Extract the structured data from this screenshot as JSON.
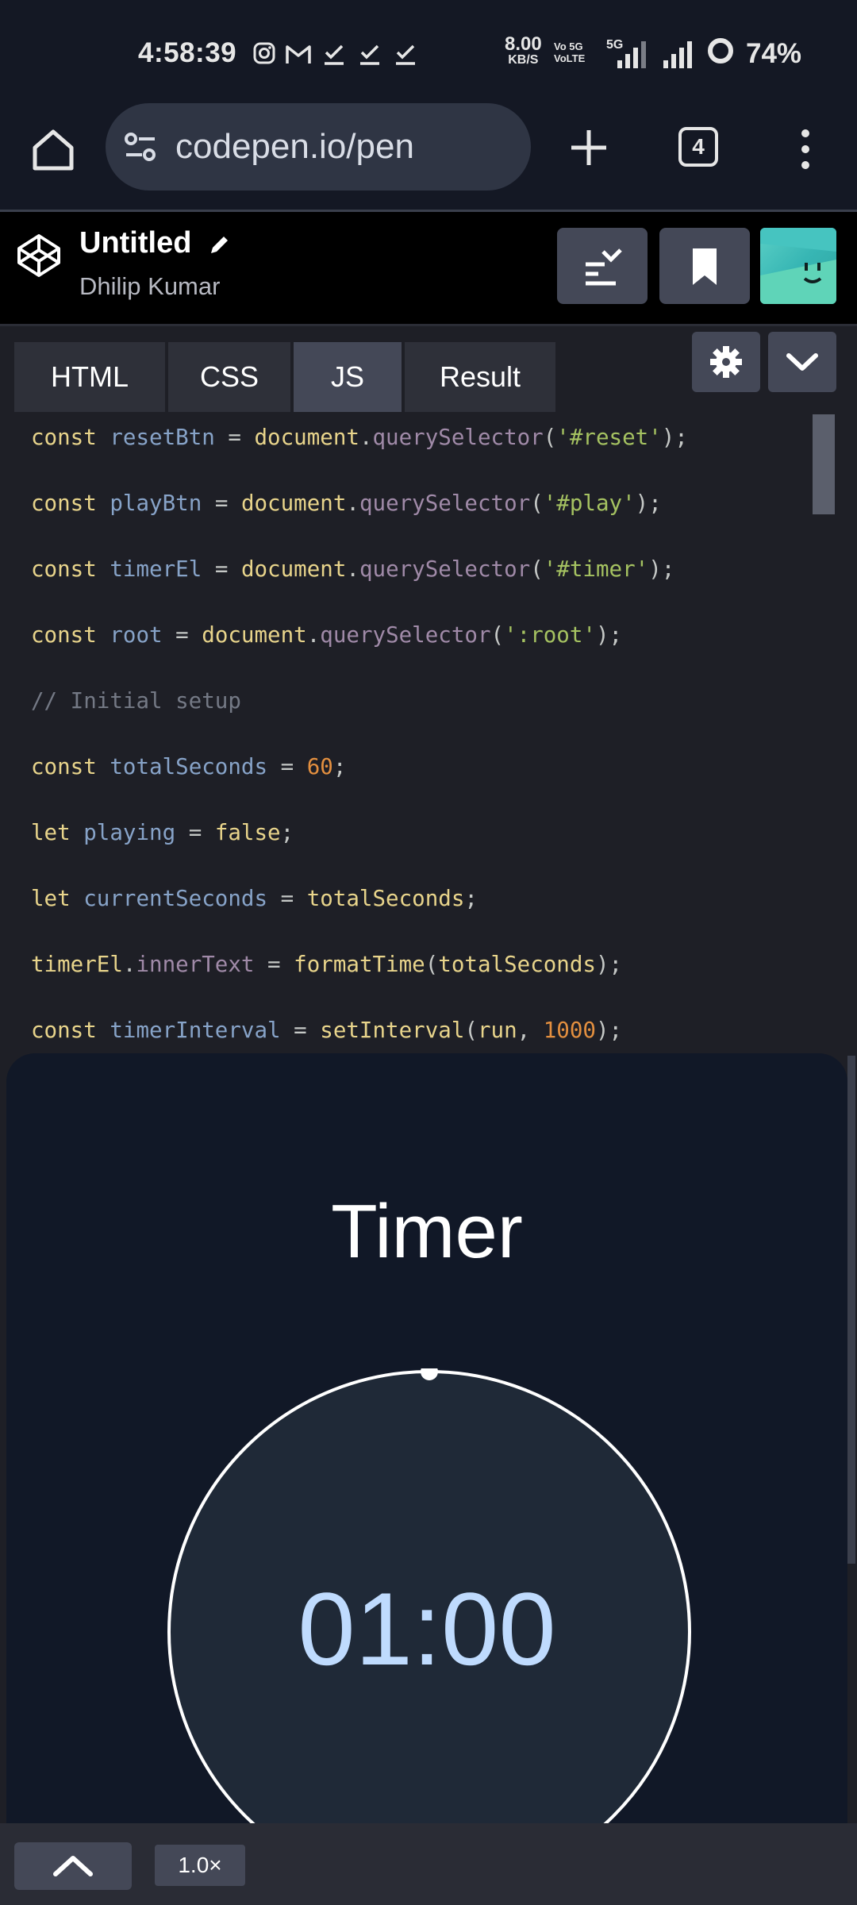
{
  "status_bar": {
    "time": "4:58:39",
    "notification_icons": [
      "instagram-icon",
      "gmail-icon",
      "check-icon",
      "check-icon",
      "check-icon"
    ],
    "net_speed": "8.00",
    "net_unit": "KB/S",
    "volte_1": "Vo 5G",
    "volte_2": "VoLTE",
    "network": "5G",
    "battery": "74%"
  },
  "browser": {
    "url": "codepen.io/pen",
    "tab_count": "4"
  },
  "pen": {
    "title": "Untitled",
    "author": "Dhilip Kumar",
    "avatar_color": "#3cc1bd"
  },
  "editor": {
    "tabs": [
      {
        "label": "HTML"
      },
      {
        "label": "CSS"
      },
      {
        "label": "JS"
      },
      {
        "label": "Result"
      }
    ],
    "active_tab": "JS",
    "code_lines": [
      [
        [
          "k",
          "const"
        ],
        [
          "p",
          " "
        ],
        [
          "v",
          "resetBtn"
        ],
        [
          "p",
          " = "
        ],
        [
          "f",
          "document"
        ],
        [
          "p",
          "."
        ],
        [
          "m",
          "querySelector"
        ],
        [
          "p",
          "("
        ],
        [
          "s",
          "'#reset'"
        ],
        [
          "p",
          ");"
        ]
      ],
      [
        [
          "k",
          "const"
        ],
        [
          "p",
          " "
        ],
        [
          "v",
          "playBtn"
        ],
        [
          "p",
          " = "
        ],
        [
          "f",
          "document"
        ],
        [
          "p",
          "."
        ],
        [
          "m",
          "querySelector"
        ],
        [
          "p",
          "("
        ],
        [
          "s",
          "'#play'"
        ],
        [
          "p",
          ");"
        ]
      ],
      [
        [
          "k",
          "const"
        ],
        [
          "p",
          " "
        ],
        [
          "v",
          "timerEl"
        ],
        [
          "p",
          " = "
        ],
        [
          "f",
          "document"
        ],
        [
          "p",
          "."
        ],
        [
          "m",
          "querySelector"
        ],
        [
          "p",
          "("
        ],
        [
          "s",
          "'#timer'"
        ],
        [
          "p",
          ");"
        ]
      ],
      [
        [
          "k",
          "const"
        ],
        [
          "p",
          " "
        ],
        [
          "v",
          "root"
        ],
        [
          "p",
          " = "
        ],
        [
          "f",
          "document"
        ],
        [
          "p",
          "."
        ],
        [
          "m",
          "querySelector"
        ],
        [
          "p",
          "("
        ],
        [
          "s",
          "':root'"
        ],
        [
          "p",
          ");"
        ]
      ],
      [
        [
          "c",
          "// Initial setup"
        ]
      ],
      [
        [
          "k",
          "const"
        ],
        [
          "p",
          " "
        ],
        [
          "v",
          "totalSeconds"
        ],
        [
          "p",
          " = "
        ],
        [
          "n",
          "60"
        ],
        [
          "p",
          ";"
        ]
      ],
      [
        [
          "k",
          "let"
        ],
        [
          "p",
          " "
        ],
        [
          "v",
          "playing"
        ],
        [
          "p",
          " = "
        ],
        [
          "k",
          "false"
        ],
        [
          "p",
          ";"
        ]
      ],
      [
        [
          "k",
          "let"
        ],
        [
          "p",
          " "
        ],
        [
          "v",
          "currentSeconds"
        ],
        [
          "p",
          " = "
        ],
        [
          "f",
          "totalSeconds"
        ],
        [
          "p",
          ";"
        ]
      ],
      [
        [
          "f",
          "timerEl"
        ],
        [
          "p",
          "."
        ],
        [
          "m",
          "innerText"
        ],
        [
          "p",
          " = "
        ],
        [
          "f",
          "formatTime"
        ],
        [
          "p",
          "("
        ],
        [
          "f",
          "totalSeconds"
        ],
        [
          "p",
          ");"
        ]
      ],
      [
        [
          "k",
          "const"
        ],
        [
          "p",
          " "
        ],
        [
          "v",
          "timerInterval"
        ],
        [
          "p",
          " = "
        ],
        [
          "f",
          "setInterval"
        ],
        [
          "p",
          "("
        ],
        [
          "f",
          "run"
        ],
        [
          "p",
          ", "
        ],
        [
          "n",
          "1000"
        ],
        [
          "p",
          ");"
        ]
      ]
    ]
  },
  "result": {
    "title": "Timer",
    "timer_value": "01:00",
    "progress": 1.0,
    "background": "#111827",
    "accent": "#bfdbfe"
  },
  "bottom_bar": {
    "zoom": "1.0×"
  }
}
